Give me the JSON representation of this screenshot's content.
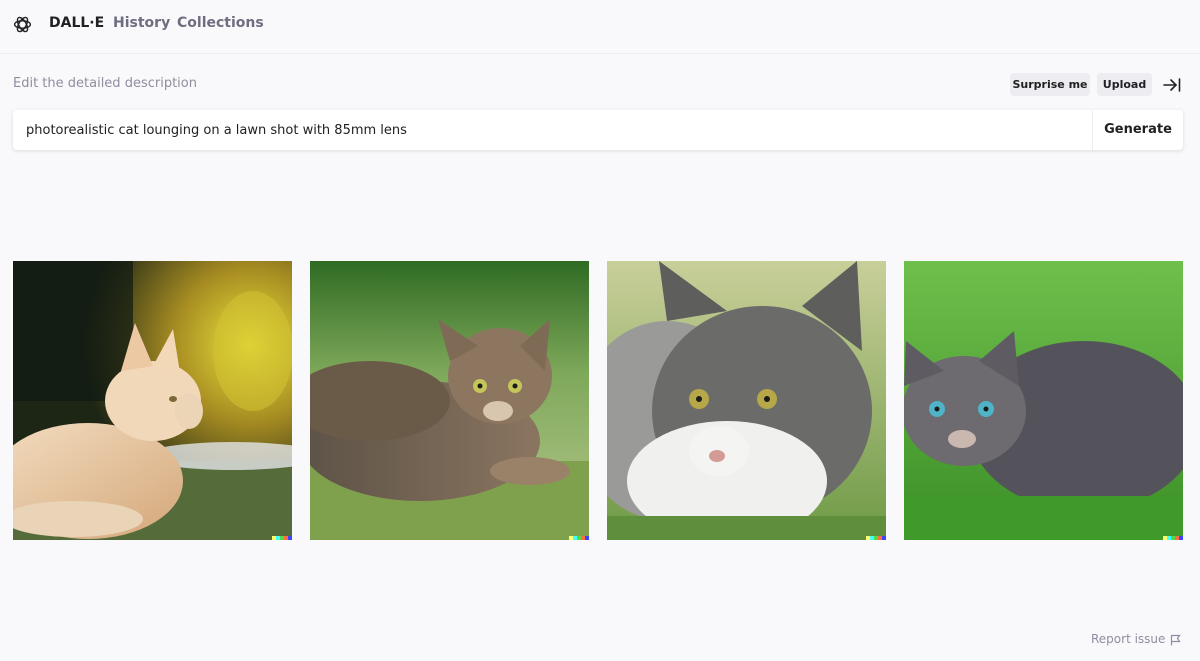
{
  "nav": {
    "brand": "DALL·E",
    "history": "History",
    "collections": "Collections"
  },
  "prompt": {
    "label": "Edit the detailed description",
    "surprise_label": "Surprise me",
    "upload_label": "Upload",
    "value": "photorealistic cat lounging on a lawn shot with 85mm lens",
    "generate_label": "Generate"
  },
  "results": [
    {
      "description": "orange cat in side profile lying on shaded grass"
    },
    {
      "description": "tabby cat lying on sunlit grass"
    },
    {
      "description": "gray and white cat close-up lying in grass"
    },
    {
      "description": "gray tabby cat with blue eyes lying on green lawn"
    }
  ],
  "footer": {
    "report_label": "Report issue"
  },
  "icons": {
    "logo": "openai-logo-icon",
    "collapse": "collapse-panel-icon",
    "flag": "flag-icon"
  },
  "colors": {
    "background": "#f9f9fb",
    "text": "#202123",
    "muted": "#6e6e80",
    "chip": "#ececf1",
    "signature": [
      "#ffff66",
      "#42ffff",
      "#51da4c",
      "#ff6e3c",
      "#3c46ff"
    ]
  }
}
